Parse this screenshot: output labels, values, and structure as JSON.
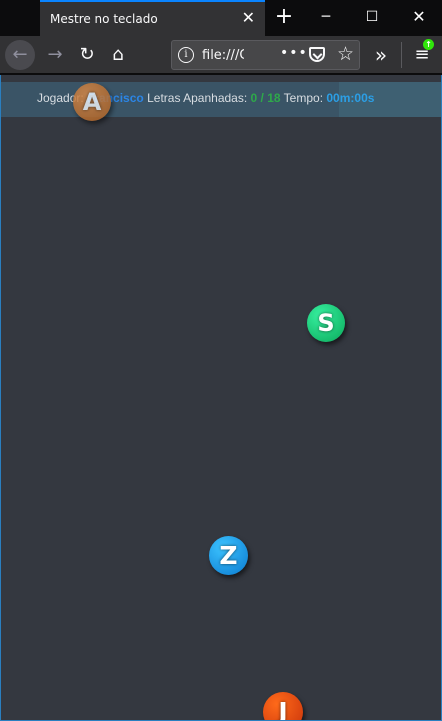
{
  "browser": {
    "tab_title": "Mestre no teclado",
    "tab_close": "✕",
    "new_tab": "+",
    "url": "file:///C",
    "url_more": "•••",
    "window_controls": {
      "minimize": "─",
      "maximize": "☐",
      "close": "✕"
    }
  },
  "hud": {
    "player_label": "Jogador:",
    "player_name": "Francisco",
    "caught_label": "Letras Apanhadas:",
    "caught_value": "0 / 18",
    "time_label": "Tempo:",
    "time_value": "00m:00s"
  },
  "letters": [
    {
      "letter": "A",
      "color": "#c07a3e"
    },
    {
      "letter": "S",
      "color": "#10d97a"
    },
    {
      "letter": "Z",
      "color": "#1aa3f0"
    },
    {
      "letter": "J",
      "color": "#e8470f"
    }
  ],
  "colors": {
    "accent": "#0a84ff",
    "page_background": "#343840",
    "hud_background": "#3a5466"
  }
}
